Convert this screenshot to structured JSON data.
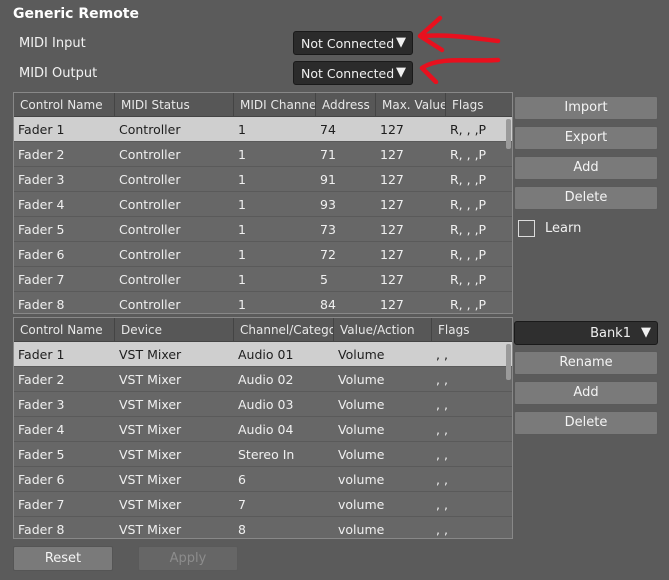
{
  "title": "Generic Remote",
  "midi_input": {
    "label": "MIDI Input",
    "value": "Not Connected"
  },
  "midi_output": {
    "label": "MIDI Output",
    "value": "Not Connected"
  },
  "top_table": {
    "columns": [
      "Control Name",
      "MIDI Status",
      "MIDI Channel",
      "Address",
      "Max. Value",
      "Flags"
    ],
    "rows": [
      [
        "Fader 1",
        "Controller",
        "1",
        "74",
        "127",
        "R, , ,P"
      ],
      [
        "Fader 2",
        "Controller",
        "1",
        "71",
        "127",
        "R, , ,P"
      ],
      [
        "Fader 3",
        "Controller",
        "1",
        "91",
        "127",
        "R, , ,P"
      ],
      [
        "Fader 4",
        "Controller",
        "1",
        "93",
        "127",
        "R, , ,P"
      ],
      [
        "Fader 5",
        "Controller",
        "1",
        "73",
        "127",
        "R, , ,P"
      ],
      [
        "Fader 6",
        "Controller",
        "1",
        "72",
        "127",
        "R, , ,P"
      ],
      [
        "Fader 7",
        "Controller",
        "1",
        "5",
        "127",
        "R, , ,P"
      ],
      [
        "Fader 8",
        "Controller",
        "1",
        "84",
        "127",
        "R, , ,P"
      ]
    ]
  },
  "top_buttons": {
    "import": "Import",
    "export": "Export",
    "add": "Add",
    "delete": "Delete"
  },
  "learn": {
    "label": "Learn",
    "checked": false
  },
  "bottom_table": {
    "columns": [
      "Control Name",
      "Device",
      "Channel/Category",
      "Value/Action",
      "Flags"
    ],
    "rows": [
      [
        "Fader 1",
        "VST Mixer",
        "Audio 01",
        "Volume",
        ", ,"
      ],
      [
        "Fader 2",
        "VST Mixer",
        "Audio 02",
        "Volume",
        ", ,"
      ],
      [
        "Fader 3",
        "VST Mixer",
        "Audio 03",
        "Volume",
        ", ,"
      ],
      [
        "Fader 4",
        "VST Mixer",
        "Audio 04",
        "Volume",
        ", ,"
      ],
      [
        "Fader 5",
        "VST Mixer",
        "Stereo In",
        "Volume",
        ", ,"
      ],
      [
        "Fader 6",
        "VST Mixer",
        "6",
        "volume",
        ", ,"
      ],
      [
        "Fader 7",
        "VST Mixer",
        "7",
        "volume",
        ", ,"
      ],
      [
        "Fader 8",
        "VST Mixer",
        "8",
        "volume",
        ", ,"
      ]
    ]
  },
  "bank": {
    "value": "Bank1"
  },
  "bank_buttons": {
    "rename": "Rename",
    "add": "Add",
    "delete": "Delete"
  },
  "footer": {
    "reset": "Reset",
    "apply": "Apply"
  },
  "colors": {
    "panel": "#5b5b5b",
    "selected_row": "#cfcfcf",
    "annotation": "#e8101e"
  },
  "icons": {
    "dropdown": "▼"
  }
}
